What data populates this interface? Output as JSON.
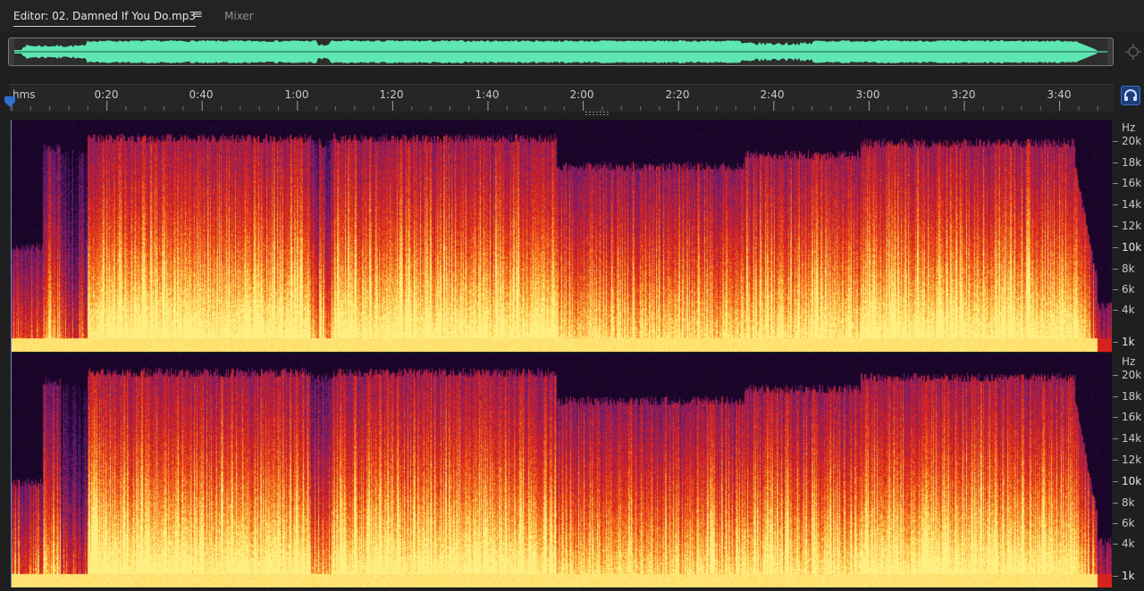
{
  "tabs": {
    "editor_label": "Editor: 02. Damned If You Do.mp3",
    "editor_menu_glyph": "≡",
    "mixer_label": "Mixer"
  },
  "ruler": {
    "unit": "hms",
    "ticks": [
      "0:20",
      "0:40",
      "1:00",
      "1:20",
      "1:40",
      "2:00",
      "2:20",
      "2:40",
      "3:00",
      "3:20",
      "3:40"
    ]
  },
  "frequency_axis": {
    "unit": "Hz",
    "labels": [
      "20k",
      "18k",
      "16k",
      "14k",
      "12k",
      "10k",
      "8k",
      "6k",
      "4k",
      "1k"
    ],
    "major_labels": [
      "10k",
      "1k"
    ]
  },
  "icons": {
    "zoom_control": "zoom-navigator-icon",
    "playhead": "playhead-marker-icon",
    "monitor": "headphones-icon"
  },
  "colors": {
    "waveform": "#5ee6b3",
    "accent": "#2f6fd1",
    "spectral_high": "#ffe066",
    "spectral_mid": "#e8321a",
    "spectral_low": "#5a1f7a"
  }
}
